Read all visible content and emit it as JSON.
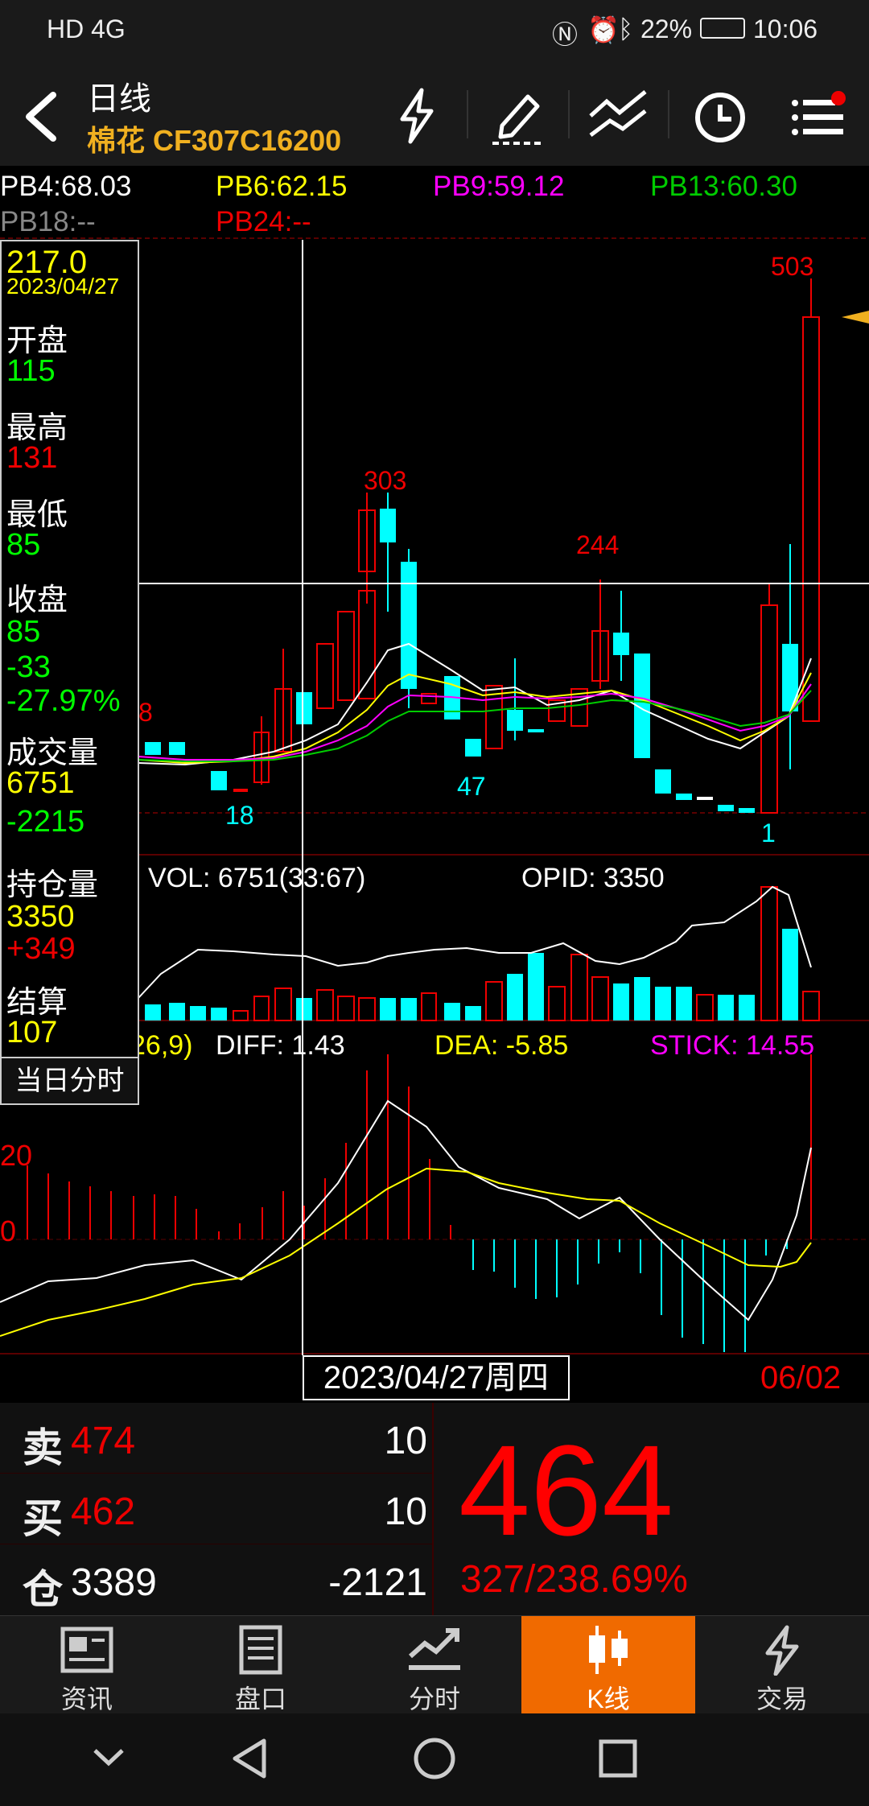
{
  "status_bar": {
    "left": "HD 4G",
    "battery": "22%",
    "time": "10:06"
  },
  "header": {
    "title": "日线",
    "subtitle": "棉花 CF307C16200"
  },
  "indicators": {
    "pb4": "PB4:68.03",
    "pb6": "PB6:62.15",
    "pb9": "PB9:59.12",
    "pb13": "PB13:60.30",
    "pb18": "PB18:--",
    "pb24": "PB24:--"
  },
  "info_panel": {
    "price": "217.0",
    "date": "2023/04/27",
    "open_label": "开盘",
    "open": "115",
    "high_label": "最高",
    "high": "131",
    "low_label": "最低",
    "low": "85",
    "close_label": "收盘",
    "close": "85",
    "change": "-33",
    "change_pct": "-27.97%",
    "volume_label": "成交量",
    "volume": "6751",
    "volume_change": "-2215",
    "oi_label": "持仓量",
    "oi": "3350",
    "oi_change": "+349",
    "settle_label": "结算",
    "settle": "107",
    "today_button": "当日分时"
  },
  "chart": {
    "price_labels": {
      "peak_503": "503",
      "peak_303": "303",
      "peak_244": "244",
      "low_18": "18",
      "low_47": "47",
      "low_1": "1",
      "edge_8": "8"
    },
    "vol_label": "VOL: 6751(33:67)",
    "opid_label": "OPID: 3350",
    "macd_param": "26,9)",
    "diff_label": "DIFF: 1.43",
    "dea_label": "DEA: -5.85",
    "stick_label": "STICK: 14.55",
    "macd_axis_20": "20",
    "macd_axis_0": "0",
    "cursor_date": "2023/04/27周四",
    "end_date": "06/02"
  },
  "quote": {
    "sell_label": "卖",
    "sell_price": "474",
    "sell_qty": "10",
    "buy_label": "买",
    "buy_price": "462",
    "buy_qty": "10",
    "pos_label": "仓",
    "pos_value": "3389",
    "pos_change": "-2121",
    "last_price": "464",
    "change": "327/238.69%"
  },
  "tabs": [
    {
      "label": "资讯",
      "icon": "news-icon"
    },
    {
      "label": "盘口",
      "icon": "orderbook-icon"
    },
    {
      "label": "分时",
      "icon": "intraday-icon"
    },
    {
      "label": "K线",
      "icon": "candlestick-icon"
    },
    {
      "label": "交易",
      "icon": "trade-icon"
    }
  ],
  "colors": {
    "up": "#e00000",
    "down": "#00ffff",
    "accent": "#f06a00",
    "yellow": "#ffff00",
    "magenta": "#ff00ff",
    "green": "#00cc00"
  }
}
